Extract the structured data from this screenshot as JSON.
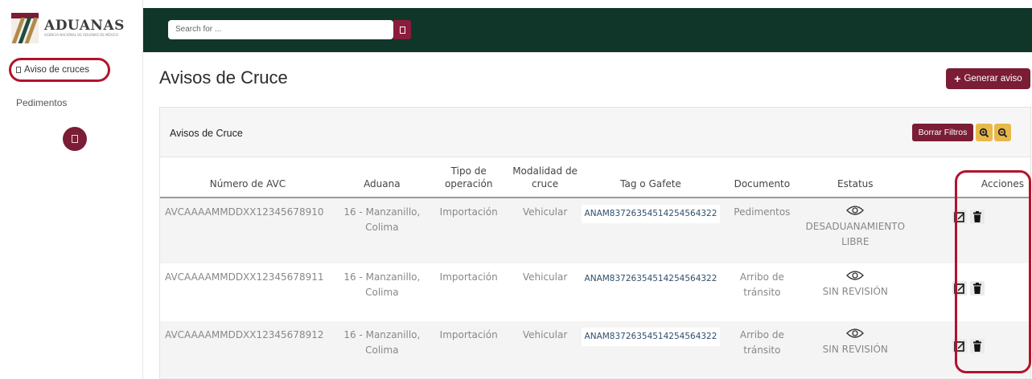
{
  "sidebar": {
    "logo_title": "ADUANAS",
    "logo_subtitle": "AGENCIA NACIONAL DE ADUANAS DE MÉXICO",
    "items": [
      {
        "label": "Aviso de cruces",
        "active": true
      },
      {
        "label": "Pedimentos",
        "active": false
      }
    ]
  },
  "topbar": {
    "search_placeholder": "Search for ..."
  },
  "page": {
    "title": "Avisos de Cruce",
    "generate_button": "Generar aviso"
  },
  "card": {
    "title": "Avisos de Cruce",
    "clear_filters": "Borrar Filtros"
  },
  "table": {
    "headers": [
      "Número de AVC",
      "Aduana",
      "Tipo de operación",
      "Modalidad de cruce",
      "Tag o Gafete",
      "Documento",
      "Estatus",
      "Acciones"
    ],
    "rows": [
      {
        "avc": "AVCAAAAMMDDXX12345678910",
        "aduana": "16 - Manzanillo, Colima",
        "tipo": "Importación",
        "modalidad": "Vehicular",
        "tag": "ANAM837263545142545643​22",
        "documento": "Pedimentos",
        "estatus": "DESADUANAMIENTO LIBRE"
      },
      {
        "avc": "AVCAAAAMMDDXX12345678911",
        "aduana": "16 - Manzanillo, Colima",
        "tipo": "Importación",
        "modalidad": "Vehicular",
        "tag": "ANAM837263545142545643​22",
        "documento": "Arribo de tránsito",
        "estatus": "SIN REVISIÓN"
      },
      {
        "avc": "AVCAAAAMMDDXX12345678912",
        "aduana": "16 - Manzanillo, Colima",
        "tipo": "Importación",
        "modalidad": "Vehicular",
        "tag": "ANAM837263545142545643​22",
        "documento": "Arribo de tránsito",
        "estatus": "SIN REVISIÓN"
      }
    ]
  },
  "colors": {
    "topbar": "#10362a",
    "brand": "#7a1d35",
    "highlight_outline": "#b3132b",
    "zoom_button": "#e8b84a"
  },
  "icons": [
    "search-icon",
    "plus-icon",
    "zoom-in-icon",
    "zoom-out-icon",
    "eye-icon",
    "edit-icon",
    "trash-icon"
  ]
}
